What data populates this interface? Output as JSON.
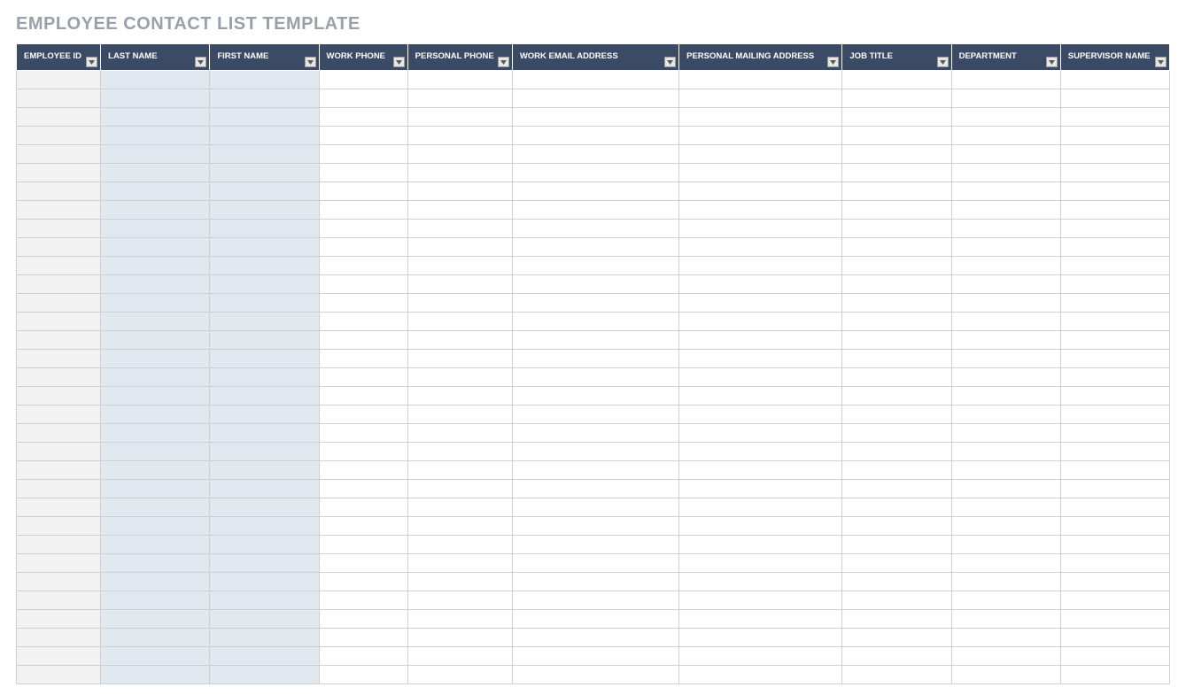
{
  "title": "EMPLOYEE CONTACT LIST TEMPLATE",
  "columns": [
    {
      "label": "EMPLOYEE ID",
      "width_class": "w-id",
      "body_class": "c-grey"
    },
    {
      "label": "LAST NAME",
      "width_class": "w-name",
      "body_class": "c-blue"
    },
    {
      "label": "FIRST NAME",
      "width_class": "w-name2",
      "body_class": "c-blue"
    },
    {
      "label": "WORK PHONE",
      "width_class": "w-phone",
      "body_class": "c-white"
    },
    {
      "label": "PERSONAL PHONE",
      "width_class": "w-phone2",
      "body_class": "c-white"
    },
    {
      "label": "WORK EMAIL ADDRESS",
      "width_class": "w-email",
      "body_class": "c-white"
    },
    {
      "label": "PERSONAL MAILING ADDRESS",
      "width_class": "w-addr",
      "body_class": "c-white"
    },
    {
      "label": "JOB TITLE",
      "width_class": "w-job",
      "body_class": "c-white"
    },
    {
      "label": "DEPARTMENT",
      "width_class": "w-dept",
      "body_class": "c-white"
    },
    {
      "label": "SUPERVISOR NAME",
      "width_class": "w-sup",
      "body_class": "c-white"
    }
  ],
  "row_count": 33
}
